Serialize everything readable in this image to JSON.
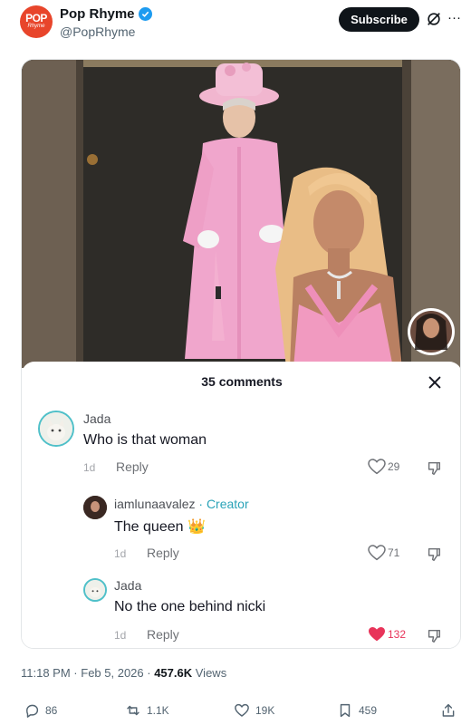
{
  "author": {
    "display_name": "Pop Rhyme",
    "handle": "@PopRhyme",
    "avatar_text_top": "POP",
    "avatar_text_bottom": "Rhyme"
  },
  "header": {
    "subscribe_label": "Subscribe",
    "grok_icon": "grok-icon",
    "more_icon": "more-icon"
  },
  "comments_panel": {
    "title": "35 comments",
    "comments": [
      {
        "user": "Jada",
        "is_creator": false,
        "text": "Who is that woman",
        "date": "1d",
        "reply_label": "Reply",
        "likes": "29",
        "liked": false
      },
      {
        "user": "iamlunaavalez",
        "creator_label": "· Creator",
        "is_creator": true,
        "text": "The queen 👑",
        "date": "1d",
        "reply_label": "Reply",
        "likes": "71",
        "liked": false
      },
      {
        "user": "Jada",
        "is_creator": false,
        "text": "No the one behind nicki",
        "date": "1d",
        "reply_label": "Reply",
        "likes": "132",
        "liked": true
      }
    ]
  },
  "post_meta": {
    "time": "11:18 PM",
    "date": "Feb 5, 2026",
    "views_count": "457.6K",
    "views_label": "Views"
  },
  "actions": {
    "replies": "86",
    "reposts": "1.1K",
    "likes": "19K",
    "bookmarks": "459"
  },
  "colors": {
    "verified": "#1d9bf0",
    "liked_heart": "#e8345a",
    "creator_tag": "#2aa3b8",
    "avatar_bg": "#e8452b"
  }
}
